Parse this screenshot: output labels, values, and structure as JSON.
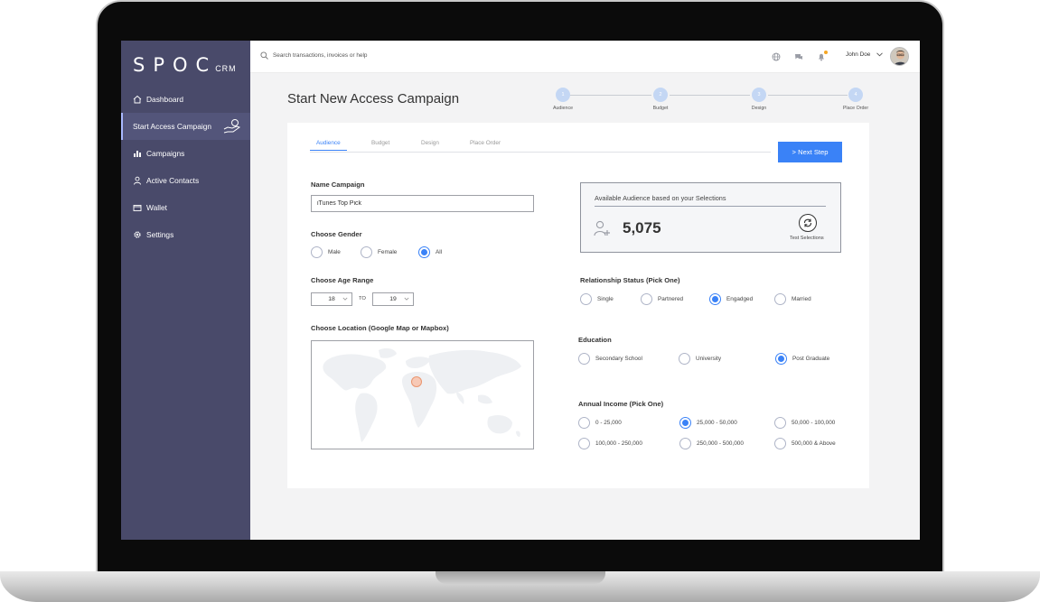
{
  "app": {
    "logo_main": "SPOC",
    "logo_sub": "CRM"
  },
  "sidebar": {
    "items": [
      {
        "label": "Dashboard",
        "icon": "home-icon"
      },
      {
        "label": "Start Access Campaign",
        "icon": "hand-coin-icon",
        "active": true
      },
      {
        "label": "Campaigns",
        "icon": "bar-chart-icon"
      },
      {
        "label": "Active Contacts",
        "icon": "person-icon"
      },
      {
        "label": "Wallet",
        "icon": "wallet-icon"
      },
      {
        "label": "Settings",
        "icon": "gear-icon"
      }
    ]
  },
  "topbar": {
    "search_placeholder": "Search transactions, invoices or help",
    "icons": [
      "globe-icon",
      "chat-icon",
      "bell-icon"
    ],
    "user_name": "John Doe"
  },
  "page": {
    "title": "Start New Access Campaign"
  },
  "stepper": {
    "steps": [
      {
        "number": "1",
        "label": "Audience"
      },
      {
        "number": "2",
        "label": "Budget"
      },
      {
        "number": "3",
        "label": "Design"
      },
      {
        "number": "4",
        "label": "Place Order"
      }
    ]
  },
  "tabs": [
    "Audience",
    "Budget",
    "Design",
    "Place Order"
  ],
  "active_tab": "Audience",
  "next_button": "> Next Step",
  "form": {
    "name_label": "Name Campaign",
    "name_value": "iTunes Top Pick",
    "gender_label": "Choose Gender",
    "gender_options": [
      "Male",
      "Female",
      "All"
    ],
    "gender_selected": "All",
    "age_label": "Choose Age Range",
    "age_from": "18",
    "age_to_label": "TO",
    "age_to": "19",
    "location_label": "Choose Location (Google Map or Mapbox)"
  },
  "audience": {
    "title": "Available Audience based on your Selections",
    "count": "5,075",
    "test_label": "Test Selections"
  },
  "relationship": {
    "label": "Relationship Status (Pick One)",
    "options": [
      "Single",
      "Partnered",
      "Engadged",
      "Married"
    ],
    "selected": "Engadged"
  },
  "education": {
    "label": "Education",
    "options": [
      "Secondary School",
      "University",
      "Post Graduate"
    ],
    "selected": "Post Graduate"
  },
  "income": {
    "label": "Annual Income (Pick One)",
    "options": [
      "0 - 25,000",
      "25,000 - 50,000",
      "50,000 - 100,000",
      "100,000 - 250,000",
      "250,000 - 500,000",
      "500,000 & Above"
    ],
    "selected": "25,000 - 50,000"
  },
  "colors": {
    "sidebar": "#494a6a",
    "accent": "#3a82f7",
    "step_circle": "#c4d7f4"
  }
}
